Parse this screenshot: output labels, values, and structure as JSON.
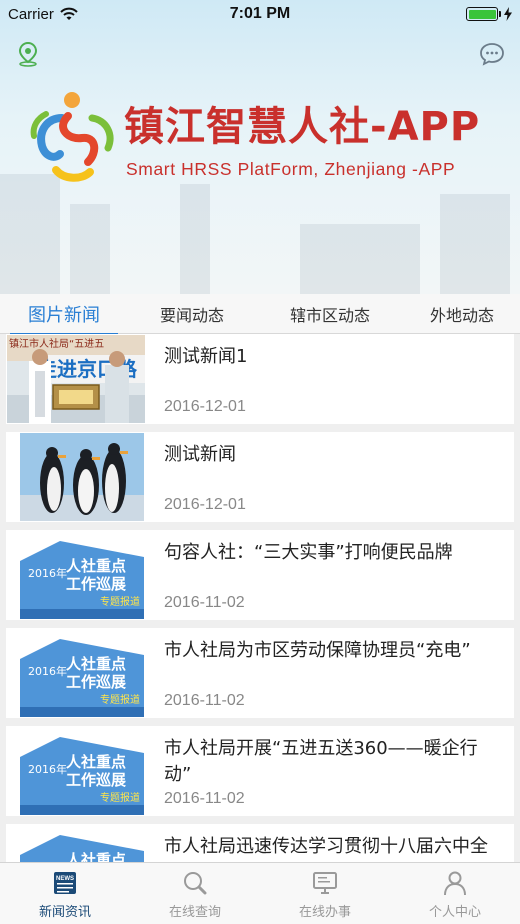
{
  "status_bar": {
    "carrier": "Carrier",
    "time": "7:01 PM",
    "battery_level": 1.0
  },
  "header": {
    "title": "镇江智慧人社-APP",
    "subtitle": "Smart HRSS PlatForm, Zhenjiang -APP",
    "location_icon": "location-pin-icon",
    "message_icon": "chat-bubble-icon"
  },
  "tabs": [
    {
      "label": "图片新闻",
      "active": true
    },
    {
      "label": "要闻动态",
      "active": false
    },
    {
      "label": "辖市区动态",
      "active": false
    },
    {
      "label": "外地动态",
      "active": false
    }
  ],
  "news": [
    {
      "title": "测试新闻1",
      "date": "2016-12-01",
      "thumb": "ceremony-photo"
    },
    {
      "title": "测试新闻",
      "date": "2016-12-01",
      "thumb": "penguins-photo"
    },
    {
      "title": " 句容人社：“三大实事”打响便民品牌",
      "date": "2016-11-02",
      "thumb": "inspection-banner"
    },
    {
      "title": " 市人社局为市区劳动保障协理员“充电”",
      "date": "2016-11-02",
      "thumb": "inspection-banner"
    },
    {
      "title": "市人社局开展“五进五送360——暖企行动”",
      "date": "2016-11-02",
      "thumb": "inspection-banner"
    },
    {
      "title": "市人社局迅速传达学习贯彻十八届六中全会精神",
      "date": "",
      "thumb": "inspection-banner"
    }
  ],
  "thumb_text": {
    "ceremony_top": "镇江市人社局“五进五",
    "ceremony_mid": "走进京口路",
    "banner_year": "2016年",
    "banner_line1": "人社重点",
    "banner_line2": "工作巡展",
    "banner_tag": "专题报道"
  },
  "tabbar": [
    {
      "label": "新闻资讯",
      "icon": "newspaper-icon",
      "active": true
    },
    {
      "label": "在线查询",
      "icon": "search-icon",
      "active": false
    },
    {
      "label": "在线办事",
      "icon": "monitor-icon",
      "active": false
    },
    {
      "label": "个人中心",
      "icon": "person-icon",
      "active": false
    }
  ],
  "colors": {
    "accent": "#2a7fd4",
    "brand_red": "#c9302c",
    "tabbar_active": "#1b4a77"
  }
}
